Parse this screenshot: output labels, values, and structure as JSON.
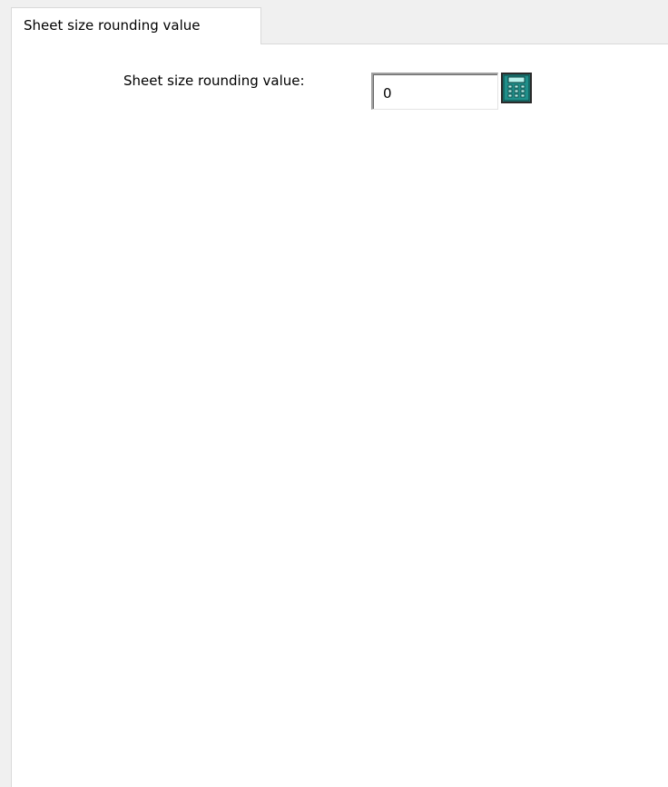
{
  "tabs": [
    {
      "label": "Sheet size rounding value"
    }
  ],
  "form": {
    "rounding_label": "Sheet size rounding value:",
    "rounding_value": "0",
    "calculator_icon": "calculator-icon"
  },
  "colors": {
    "calculator_body": "#1f8f8a",
    "calculator_screen": "#b7f0ea"
  }
}
